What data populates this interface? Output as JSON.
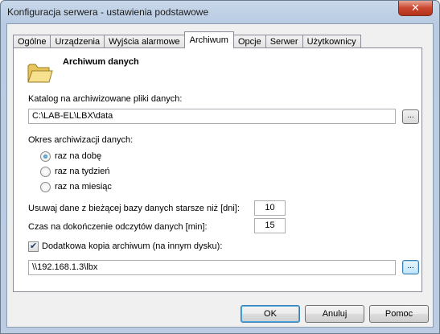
{
  "window": {
    "title": "Konfiguracja serwera - ustawienia podstawowe",
    "close_glyph": "✕"
  },
  "tabs": [
    {
      "label": "Ogólne",
      "active": false
    },
    {
      "label": "Urządzenia",
      "active": false
    },
    {
      "label": "Wyjścia alarmowe",
      "active": false
    },
    {
      "label": "Archiwum",
      "active": true
    },
    {
      "label": "Opcje",
      "active": false
    },
    {
      "label": "Serwer",
      "active": false
    },
    {
      "label": "Użytkownicy",
      "active": false
    }
  ],
  "archive": {
    "heading": "Archiwum danych",
    "folder_icon": "folder-icon",
    "data_dir_label": "Katalog na archiwizowane pliki danych:",
    "data_dir_value": "C:\\LAB-EL\\LBX\\data",
    "browse_label": "...",
    "period_label": "Okres archiwizacji danych:",
    "period_options": [
      {
        "label": "raz na dobę",
        "checked": true
      },
      {
        "label": "raz na tydzień",
        "checked": false
      },
      {
        "label": "raz na miesiąc",
        "checked": false
      }
    ],
    "delete_label": "Usuwaj dane z bieżącej bazy danych starsze niż [dni]:",
    "delete_value": "10",
    "timeout_label": "Czas na dokończenie odczytów danych [min]:",
    "timeout_value": "15",
    "backup_label": "Dodatkowa kopia archiwum (na innym dysku):",
    "backup_checked": true,
    "backup_value": "\\\\192.168.1.3\\lbx",
    "backup_browse_label": "..."
  },
  "buttons": {
    "ok": "OK",
    "cancel": "Anuluj",
    "help": "Pomoc"
  },
  "colors": {
    "titlebar": "#b8cbe2",
    "close": "#c9452e",
    "panel": "#ffffff",
    "client": "#f0f0f0"
  }
}
